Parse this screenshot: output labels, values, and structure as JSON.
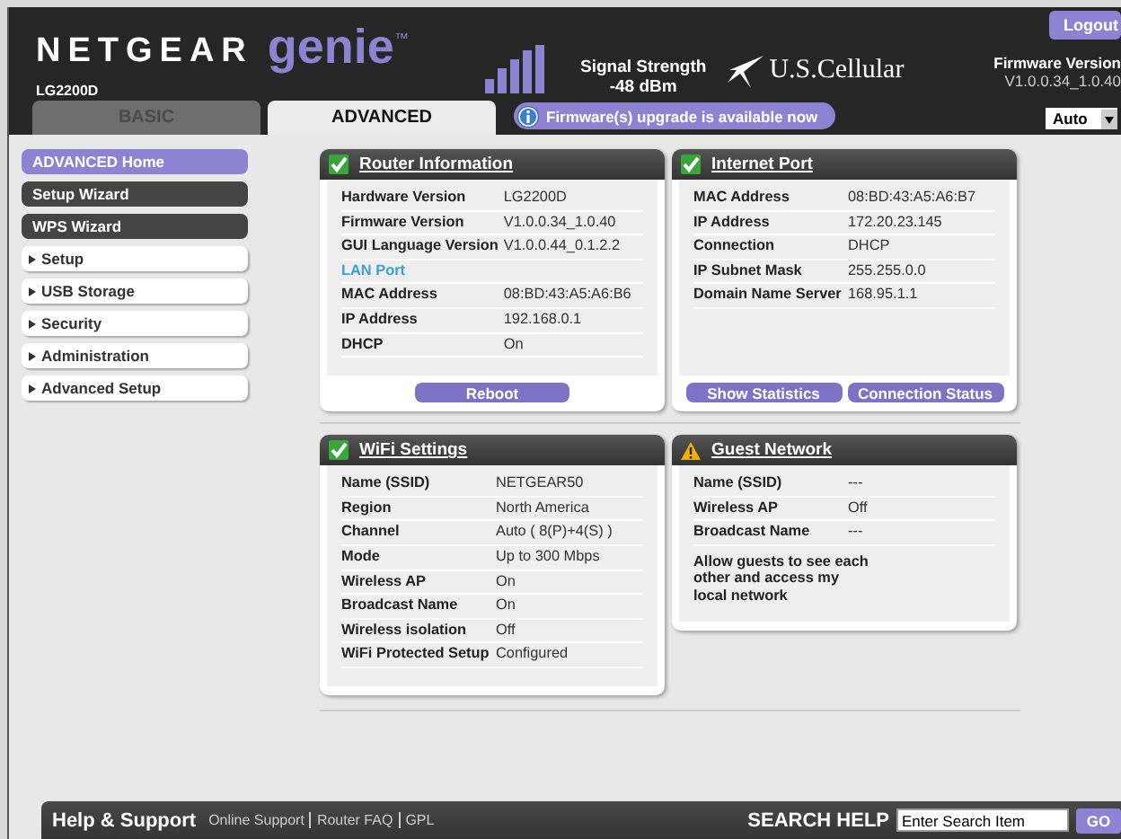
{
  "header": {
    "brand": "NETGEAR",
    "product": "genie",
    "trademark": "™",
    "model": "LG2200D",
    "signal_label": "Signal Strength",
    "signal_value": "-48 dBm",
    "carrier": "U.S.Cellular",
    "logout": "Logout",
    "firmware_label": "Firmware Version",
    "firmware_value": "V1.0.0.34_1.0.40",
    "language": "Auto"
  },
  "tabs": [
    {
      "label": "BASIC",
      "selected": false
    },
    {
      "label": "ADVANCED",
      "selected": true
    }
  ],
  "notice": "Firmware(s) upgrade is available now",
  "sidebar": [
    {
      "label": "ADVANCED Home",
      "kind": "wizard",
      "selected": true
    },
    {
      "label": "Setup Wizard",
      "kind": "wizard",
      "selected": false
    },
    {
      "label": "WPS Wizard",
      "kind": "wizard",
      "selected": false
    },
    {
      "label": "Setup",
      "kind": "menu",
      "selected": false
    },
    {
      "label": "USB Storage",
      "kind": "menu",
      "selected": false
    },
    {
      "label": "Security",
      "kind": "menu",
      "selected": false
    },
    {
      "label": "Administration",
      "kind": "menu",
      "selected": false
    },
    {
      "label": "Advanced Setup",
      "kind": "menu",
      "selected": false
    }
  ],
  "cards": [
    {
      "title": "Router Information",
      "kind": "ok",
      "rows": [
        {
          "kind": "pair",
          "label": "Hardware Version",
          "value": "LG2200D"
        },
        {
          "kind": "pair",
          "label": "Firmware Version",
          "value": "V1.0.0.34_1.0.40"
        },
        {
          "kind": "pair",
          "label": "GUI Language Version",
          "value": "V1.0.0.44_0.1.2.2"
        },
        {
          "kind": "section",
          "label": "LAN Port"
        },
        {
          "kind": "pair",
          "label": "MAC Address",
          "value": "08:BD:43:A5:A6:B6"
        },
        {
          "kind": "pair",
          "label": "IP Address",
          "value": "192.168.0.1"
        },
        {
          "kind": "pair",
          "label": "DHCP",
          "value": "On"
        }
      ],
      "buttons": [
        "Reboot"
      ]
    },
    {
      "title": "Internet Port",
      "kind": "ok",
      "rows": [
        {
          "kind": "pair",
          "label": "MAC Address",
          "value": "08:BD:43:A5:A6:B7"
        },
        {
          "kind": "pair",
          "label": "IP Address",
          "value": "172.20.23.145"
        },
        {
          "kind": "pair",
          "label": "Connection",
          "value": "DHCP"
        },
        {
          "kind": "pair",
          "label": "IP Subnet Mask",
          "value": "255.255.0.0"
        },
        {
          "kind": "pair",
          "label": "Domain Name Server",
          "value": "168.95.1.1"
        }
      ],
      "buttons": [
        "Show Statistics",
        "Connection Status"
      ]
    },
    {
      "title": "WiFi Settings",
      "kind": "ok",
      "rows": [
        {
          "kind": "pair",
          "label": "Name (SSID)",
          "value": "NETGEAR50"
        },
        {
          "kind": "pair",
          "label": "Region",
          "value": "North America"
        },
        {
          "kind": "pair",
          "label": "Channel",
          "value": "Auto ( 8(P)+4(S) )"
        },
        {
          "kind": "pair",
          "label": "Mode",
          "value": "Up to 300 Mbps"
        },
        {
          "kind": "pair",
          "label": "Wireless AP",
          "value": "On"
        },
        {
          "kind": "pair",
          "label": "Broadcast Name",
          "value": "On"
        },
        {
          "kind": "pair",
          "label": "Wireless isolation",
          "value": "Off"
        },
        {
          "kind": "pair",
          "label": "WiFi Protected Setup",
          "value": "Configured"
        }
      ]
    },
    {
      "title": "Guest Network",
      "kind": "warning",
      "rows": [
        {
          "kind": "pair",
          "label": "Name (SSID)",
          "value": "---"
        },
        {
          "kind": "pair",
          "label": "Wireless AP",
          "value": "Off"
        },
        {
          "kind": "pair",
          "label": "Broadcast Name",
          "value": "---"
        },
        {
          "kind": "note",
          "text": "Allow guests to see each other and access my local network"
        }
      ]
    }
  ],
  "footer": {
    "title": "Help & Support",
    "links": [
      "Online Support",
      "Router FAQ",
      "GPL"
    ],
    "search_label": "SEARCH HELP",
    "search_placeholder": "Enter Search Item",
    "go": "GO"
  }
}
